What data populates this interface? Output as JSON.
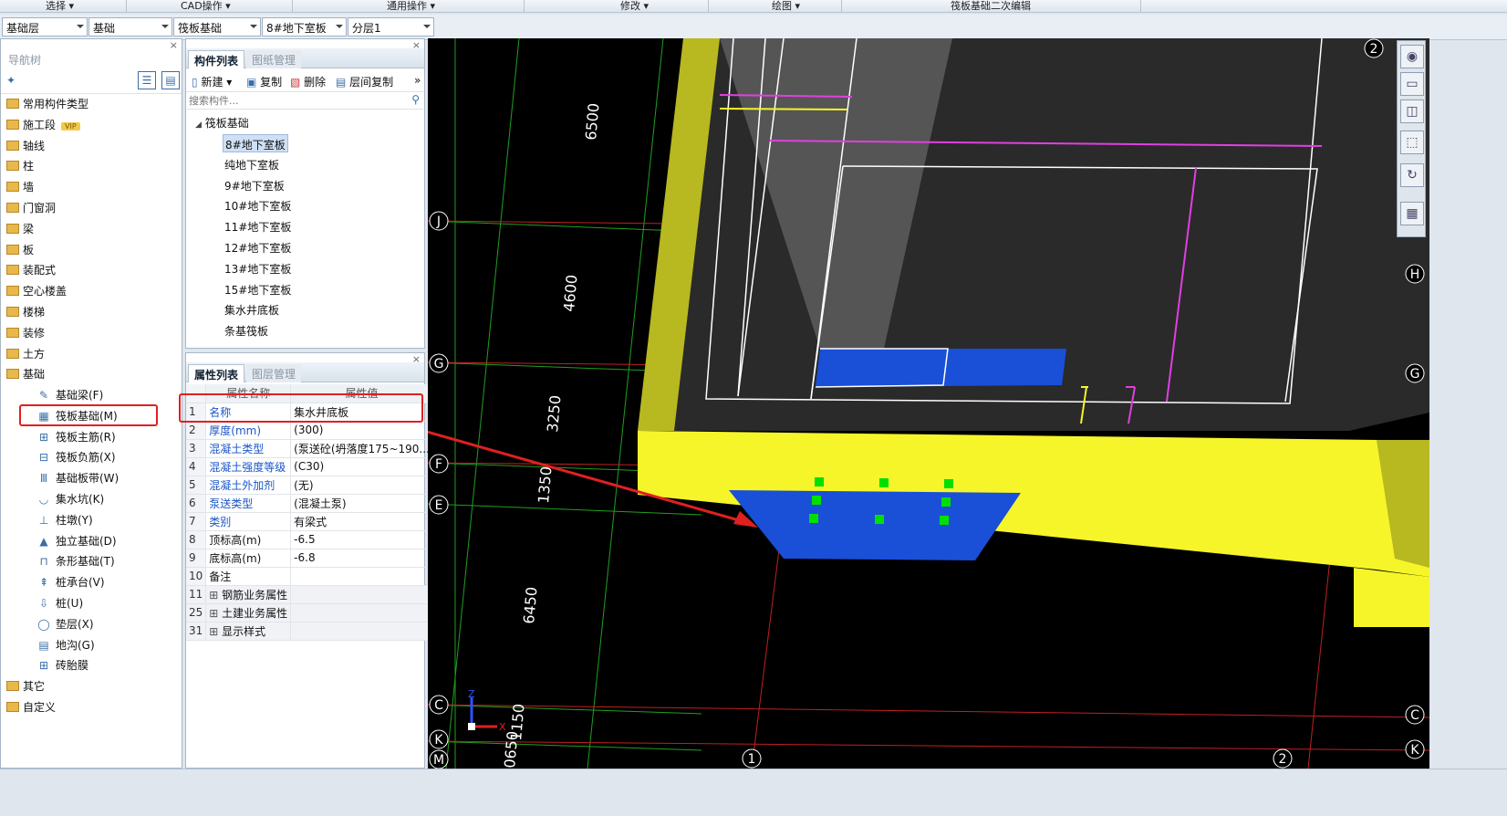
{
  "menubar": {
    "items": [
      "选择 ▾",
      "CAD操作 ▾",
      "通用操作 ▾",
      "修改 ▾",
      "绘图 ▾",
      "筏板基础二次编辑"
    ]
  },
  "selectors": [
    "基础层",
    "基础",
    "筏板基础",
    "8#地下室板",
    "分层1"
  ],
  "nav": {
    "title": "导航树",
    "categories": [
      "常用构件类型",
      "施工段",
      "轴线",
      "柱",
      "墙",
      "门窗洞",
      "梁",
      "板",
      "装配式",
      "空心楼盖",
      "楼梯",
      "装修",
      "土方",
      "基础"
    ],
    "vip": "VIP",
    "sub_items": [
      "基础梁(F)",
      "筏板基础(M)",
      "筏板主筋(R)",
      "筏板负筋(X)",
      "基础板带(W)",
      "集水坑(K)",
      "柱墩(Y)",
      "独立基础(D)",
      "条形基础(T)",
      "桩承台(V)",
      "桩(U)",
      "垫层(X)",
      "地沟(G)",
      "砖胎膜"
    ],
    "tail_categories": [
      "其它",
      "自定义"
    ]
  },
  "component_panel": {
    "tab_active": "构件列表",
    "tab_inactive": "图纸管理",
    "toolbar": {
      "new": "新建",
      "copy": "复制",
      "delete": "删除",
      "floor_copy": "层间复制"
    },
    "search_placeholder": "搜索构件...",
    "group": "筏板基础",
    "items": [
      "8#地下室板",
      "纯地下室板",
      "9#地下室板",
      "10#地下室板",
      "11#地下室板",
      "12#地下室板",
      "13#地下室板",
      "15#地下室板",
      "集水井底板",
      "条基筏板"
    ]
  },
  "property_panel": {
    "tab_active": "属性列表",
    "tab_inactive": "图层管理",
    "headers": [
      "属性名称",
      "属性值"
    ],
    "rows": [
      {
        "num": "1",
        "name": "名称",
        "value": "集水井底板"
      },
      {
        "num": "2",
        "name": "厚度(mm)",
        "value": "(300)"
      },
      {
        "num": "3",
        "name": "混凝土类型",
        "value": "(泵送砼(坍落度175~190..."
      },
      {
        "num": "4",
        "name": "混凝土强度等级",
        "value": "(C30)"
      },
      {
        "num": "5",
        "name": "混凝土外加剂",
        "value": "(无)"
      },
      {
        "num": "6",
        "name": "泵送类型",
        "value": "(混凝土泵)"
      },
      {
        "num": "7",
        "name": "类别",
        "value": "有梁式"
      },
      {
        "num": "8",
        "name": "顶标高(m)",
        "value": "-6.5"
      },
      {
        "num": "9",
        "name": "底标高(m)",
        "value": "-6.8"
      },
      {
        "num": "10",
        "name": "备注",
        "value": ""
      },
      {
        "num": "11",
        "name": "钢筋业务属性",
        "value": ""
      },
      {
        "num": "25",
        "name": "土建业务属性",
        "value": ""
      },
      {
        "num": "31",
        "name": "显示样式",
        "value": ""
      }
    ]
  },
  "canvas": {
    "dimensions": [
      "6500",
      "4600",
      "3250",
      "1350",
      "6450",
      "1150",
      "0650"
    ],
    "axis_labels_left": [
      "J",
      "G",
      "F",
      "E",
      "C",
      "K",
      "M"
    ],
    "axis_labels_right": [
      "H",
      "G",
      "C",
      "K"
    ],
    "axis_labels_top": [
      "2"
    ],
    "axis_labels_bottom": [
      "1",
      "2"
    ],
    "ucs": {
      "x": "X",
      "z": "Z"
    }
  },
  "view_tools": [
    "orbit-icon",
    "2d-view-icon",
    "3d-box-icon",
    "3d-wire-icon",
    "rotate-icon",
    "layer-icon"
  ],
  "colors": {
    "canvas_bg": "#000000",
    "slab_yellow": "#f5f52a",
    "pit_blue": "#1a4fd8",
    "rebar_magenta": "#e040e0",
    "highlight_red": "#e02020"
  }
}
